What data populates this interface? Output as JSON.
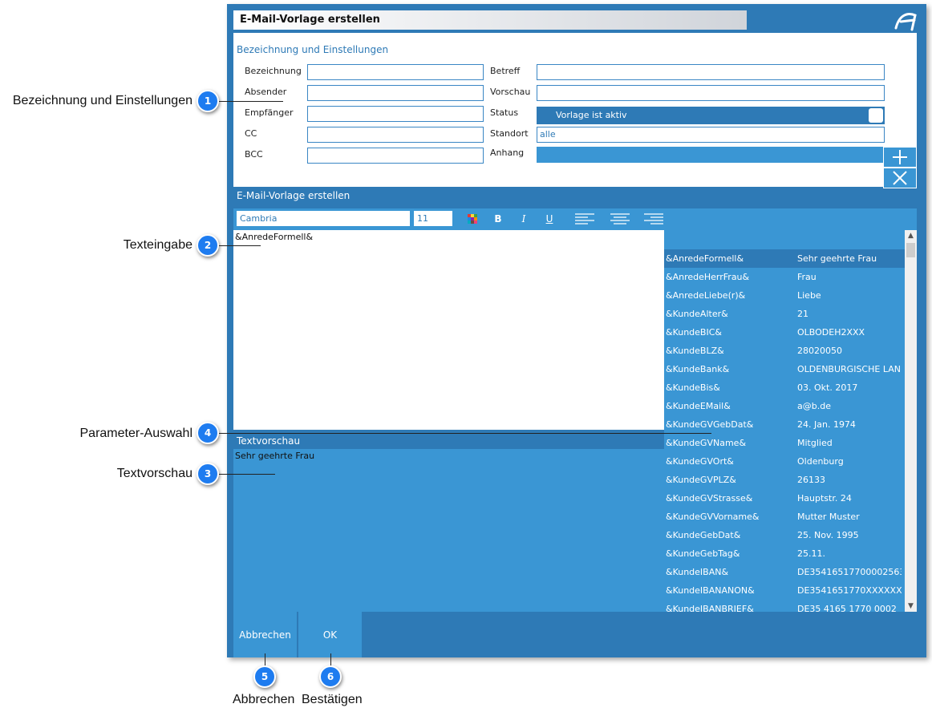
{
  "dialog": {
    "title": "E-Mail-Vorlage erstellen",
    "settings_section_title": "Bezeichnung und Einstellungen",
    "left_fields": [
      {
        "label": "Bezeichnung",
        "value": ""
      },
      {
        "label": "Absender",
        "value": ""
      },
      {
        "label": "Empfänger",
        "value": ""
      },
      {
        "label": "CC",
        "value": ""
      },
      {
        "label": "BCC",
        "value": ""
      }
    ],
    "right_fields": {
      "betreff_label": "Betreff",
      "betreff_value": "",
      "vorschau_label": "Vorschau",
      "vorschau_value": "",
      "status_label": "Status",
      "status_value": "Vorlage ist aktiv",
      "standort_label": "Standort",
      "standort_value": "alle",
      "anhang_label": "Anhang"
    },
    "editor_title": "E-Mail-Vorlage erstellen",
    "toolbar": {
      "font": "Cambria",
      "size": "11",
      "bold": "B",
      "italic": "I",
      "underline": "U"
    },
    "text_content": "&AnredeFormell&",
    "preview_header": "Textvorschau",
    "preview_text": "Sehr geehrte Frau",
    "parameters": [
      {
        "name": "&AnredeFormell&",
        "value": "Sehr geehrte Frau"
      },
      {
        "name": "&AnredeHerrFrau&",
        "value": "Frau"
      },
      {
        "name": "&AnredeLiebe(r)&",
        "value": "Liebe"
      },
      {
        "name": "&KundeAlter&",
        "value": "21"
      },
      {
        "name": "&KundeBIC&",
        "value": "OLBODEH2XXX"
      },
      {
        "name": "&KundeBLZ&",
        "value": "28020050"
      },
      {
        "name": "&KundeBank&",
        "value": "OLDENBURGISCHE LAN"
      },
      {
        "name": "&KundeBis&",
        "value": "03. Okt. 2017"
      },
      {
        "name": "&KundeEMail&",
        "value": "a@b.de"
      },
      {
        "name": "&KundeGVGebDat&",
        "value": "24. Jan. 1974"
      },
      {
        "name": "&KundeGVName&",
        "value": "Mitglied"
      },
      {
        "name": "&KundeGVOrt&",
        "value": "Oldenburg"
      },
      {
        "name": "&KundeGVPLZ&",
        "value": "26133"
      },
      {
        "name": "&KundeGVStrasse&",
        "value": "Hauptstr. 24"
      },
      {
        "name": "&KundeGVVorname&",
        "value": "Mutter Muster"
      },
      {
        "name": "&KundeGebDat&",
        "value": "25. Nov. 1995"
      },
      {
        "name": "&KundeGebTag&",
        "value": "25.11."
      },
      {
        "name": "&KundeIBAN&",
        "value": "DE35416517700002563"
      },
      {
        "name": "&KundeIBANANON&",
        "value": "DE3541651770XXXXXX"
      },
      {
        "name": "&KundeIBANBRIEF&",
        "value": "DE35 4165 1770 0002"
      }
    ],
    "cancel_label": "Abbrechen",
    "ok_label": "OK"
  },
  "callouts": [
    {
      "num": "1",
      "label": "Bezeichnung und Einstellungen"
    },
    {
      "num": "2",
      "label": "Texteingabe"
    },
    {
      "num": "3",
      "label": "Textvorschau"
    },
    {
      "num": "4",
      "label": "Parameter-Auswahl"
    },
    {
      "num": "5",
      "label": "Abbrechen"
    },
    {
      "num": "6",
      "label": "Bestätigen"
    }
  ],
  "colors": {
    "dialog_blue": "#2e7ab6",
    "light_blue": "#3a96d4",
    "badge_blue": "#1e7cf0"
  },
  "icons": [
    "app-logo-icon",
    "color-palette-icon",
    "align-left-icon",
    "align-center-icon",
    "align-right-icon",
    "plus-icon",
    "close-icon",
    "scroll-up-icon",
    "scroll-down-icon"
  ]
}
